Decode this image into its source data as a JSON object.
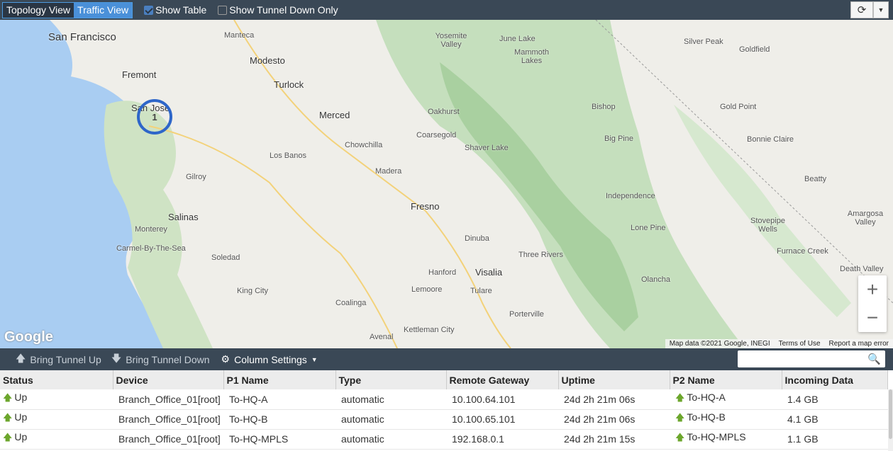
{
  "topbar": {
    "views": [
      "Topology View",
      "Traffic View"
    ],
    "show_table": "Show Table",
    "show_tunnel_down": "Show Tunnel Down Only",
    "refresh": "⟳",
    "dropdown": "▼"
  },
  "map": {
    "places": [
      "San Francisco",
      "Manteca",
      "Modesto",
      "Fremont",
      "Turlock",
      "San Jose",
      "Merced",
      "Oakhurst",
      "Coarsegold",
      "Chowchilla",
      "Los Banos",
      "Madera",
      "Gilroy",
      "Fresno",
      "Salinas",
      "Monterey",
      "Carmel-By-The-Sea",
      "Dinuba",
      "Soledad",
      "Hanford",
      "Visalia",
      "Lemoore",
      "Tulare",
      "King City",
      "Coalinga",
      "Porterville",
      "Kettleman City",
      "Avenal",
      "Yosemite Valley",
      "June Lake",
      "Mammoth Lakes",
      "Bishop",
      "Big Pine",
      "Shaver Lake",
      "Independence",
      "Lone Pine",
      "Three Rivers",
      "Olancha",
      "Silver Peak",
      "Goldfield",
      "Gold Point",
      "Bonnie Claire",
      "Beatty",
      "Amargosa Valley",
      "Stovepipe Wells",
      "Furnace Creek",
      "Death Valley"
    ],
    "cluster_count": "1",
    "zoom_in": "+",
    "zoom_out": "−",
    "logo": "Google",
    "attribution": [
      "Map data ©2021 Google, INEGI",
      "Terms of Use",
      "Report a map error"
    ]
  },
  "actions": {
    "up": "Bring Tunnel Up",
    "down": "Bring Tunnel Down",
    "columns": "Column Settings"
  },
  "table": {
    "headers": [
      "Status",
      "Device",
      "P1 Name",
      "Type",
      "Remote Gateway",
      "Uptime",
      "P2 Name",
      "Incoming Data"
    ],
    "rows": [
      [
        "Up",
        "Branch_Office_01[root]",
        "To-HQ-A",
        "automatic",
        "10.100.64.101",
        "24d 2h 21m 06s",
        "To-HQ-A",
        "1.4 GB"
      ],
      [
        "Up",
        "Branch_Office_01[root]",
        "To-HQ-B",
        "automatic",
        "10.100.65.101",
        "24d 2h 21m 06s",
        "To-HQ-B",
        "4.1 GB"
      ],
      [
        "Up",
        "Branch_Office_01[root]",
        "To-HQ-MPLS",
        "automatic",
        "192.168.0.1",
        "24d 2h 21m 15s",
        "To-HQ-MPLS",
        "1.1 GB"
      ]
    ]
  }
}
